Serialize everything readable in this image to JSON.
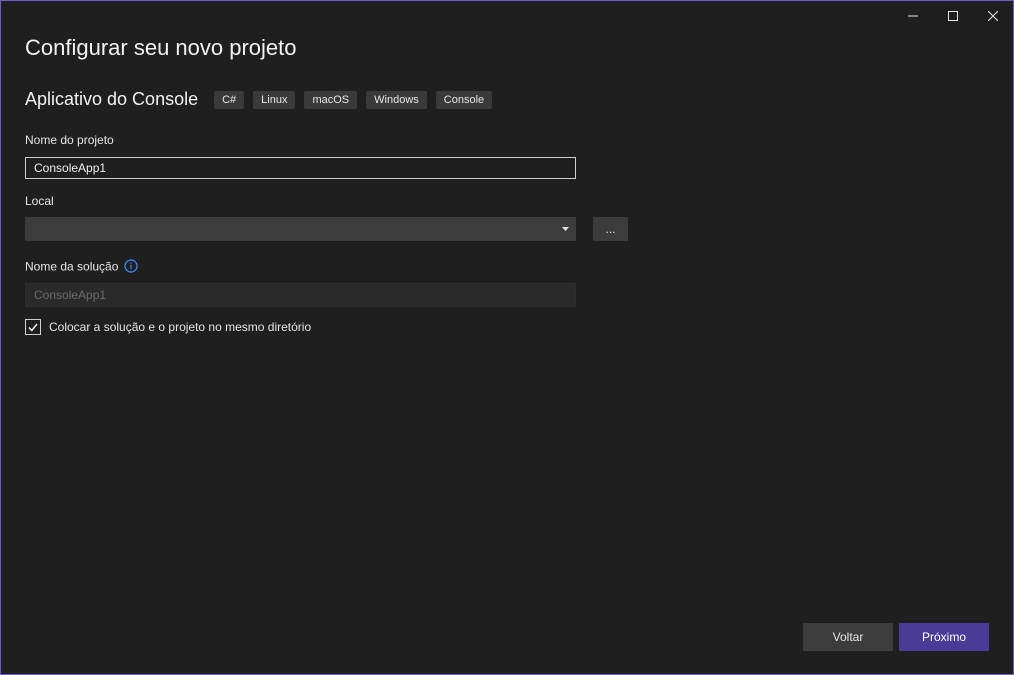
{
  "window": {
    "title": "Configurar seu novo projeto"
  },
  "template": {
    "name": "Aplicativo do Console",
    "tags": [
      "C#",
      "Linux",
      "macOS",
      "Windows",
      "Console"
    ]
  },
  "form": {
    "project_name_label": "Nome do projeto",
    "project_name_value": "ConsoleApp1",
    "location_label": "Local",
    "location_value": "",
    "browse_label": "...",
    "solution_name_label": "Nome da solução",
    "solution_name_value": "ConsoleApp1",
    "same_dir_label": "Colocar a solução e o projeto no mesmo diretório",
    "same_dir_checked": true
  },
  "buttons": {
    "back_label": "Voltar",
    "next_label": "Próximo"
  },
  "colors": {
    "accent": "#4a3c96",
    "window_border": "#6f5dc7",
    "info_icon": "#3794ff"
  }
}
